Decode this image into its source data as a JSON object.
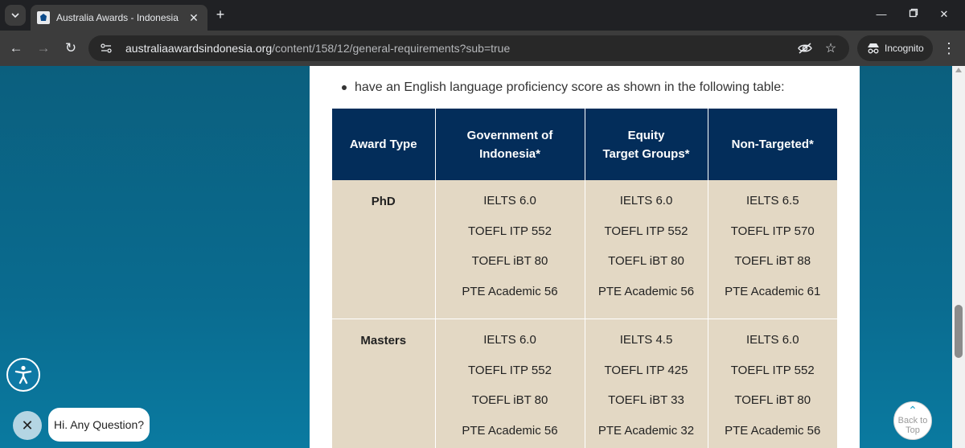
{
  "browser": {
    "tab_title": "Australia Awards - Indonesia",
    "url_host": "australiaawardsindonesia.org",
    "url_path": "/content/158/12/general-requirements?sub=true",
    "incognito_label": "Incognito"
  },
  "page": {
    "bullet_text": "have an English language proficiency score as shown in the following table:",
    "table": {
      "headers": {
        "award_type": "Award Type",
        "gov_line1": "Government of",
        "gov_line2": "Indonesia*",
        "equity_line1": "Equity",
        "equity_line2": "Target Groups*",
        "non_targeted": "Non-Targeted*"
      },
      "rows": [
        {
          "award": "PhD",
          "government": [
            "IELTS 6.0",
            "TOEFL ITP 552",
            "TOEFL iBT 80",
            "PTE Academic 56"
          ],
          "equity": [
            "IELTS 6.0",
            "TOEFL ITP 552",
            "TOEFL iBT 80",
            "PTE Academic 56"
          ],
          "non_targeted": [
            "IELTS 6.5",
            "TOEFL ITP 570",
            "TOEFL iBT 88",
            "PTE Academic 61"
          ]
        },
        {
          "award": "Masters",
          "government": [
            "IELTS 6.0",
            "TOEFL ITP 552",
            "TOEFL iBT 80",
            "PTE Academic 56"
          ],
          "equity": [
            "IELTS 4.5",
            "TOEFL ITP 425",
            "TOEFL iBT 33",
            "PTE Academic 32"
          ],
          "non_targeted": [
            "IELTS 6.0",
            "TOEFL ITP 552",
            "TOEFL iBT 80",
            "PTE Academic 56"
          ]
        }
      ]
    }
  },
  "widgets": {
    "chat_prompt": "Hi. Any Question?",
    "back_to_top_line1": "Back to",
    "back_to_top_line2": "Top"
  },
  "colors": {
    "table_header_bg": "#032d5a",
    "table_cell_bg": "#e3d8c4",
    "page_bg": "#0a6b8f"
  }
}
